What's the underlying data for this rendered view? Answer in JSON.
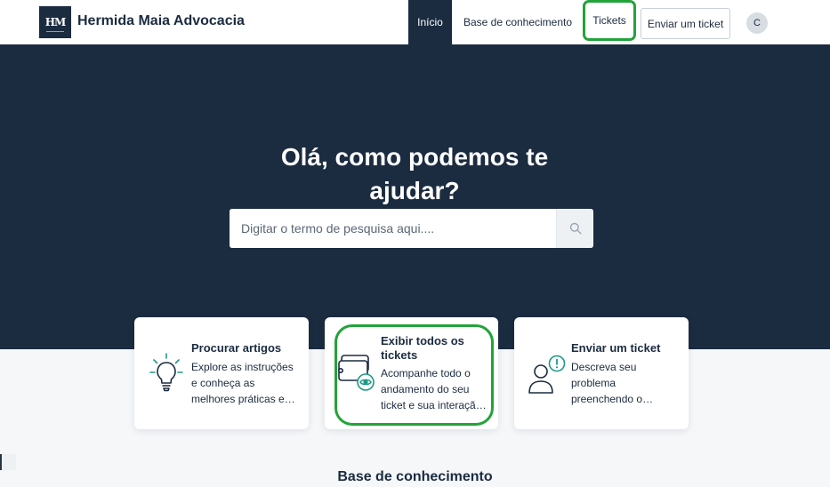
{
  "header": {
    "logo_text": "HM",
    "brand": "Hermida Maia Advocacia",
    "nav": {
      "home": "Início",
      "knowledge_base": "Base de conhecimento",
      "tickets": "Tickets",
      "submit_ticket": "Enviar um ticket"
    },
    "avatar_initial": "C"
  },
  "hero": {
    "title": "Olá, como podemos te ajudar?",
    "search_placeholder": "Digitar o termo de pesquisa aqui....",
    "search_icon": "search-icon"
  },
  "cards": [
    {
      "icon": "lightbulb-icon",
      "title": "Procurar artigos",
      "description": "Explore as instruções e conheça as melhores práticas em nossa base de conhecimento."
    },
    {
      "icon": "tickets-view-icon",
      "title": "Exibir todos os tickets",
      "description": "Acompanhe todo o andamento do seu ticket e sua interação com a nossa equipe."
    },
    {
      "icon": "user-alert-icon",
      "title": "Enviar um ticket",
      "description": "Descreva seu problema preenchendo o formulário do ticket e entraremos em contato."
    }
  ],
  "section": {
    "knowledge_base_title": "Base de conhecimento"
  },
  "colors": {
    "navy": "#1b2b40",
    "accent_teal": "#1c9a86",
    "highlight_green": "#22a33a"
  }
}
